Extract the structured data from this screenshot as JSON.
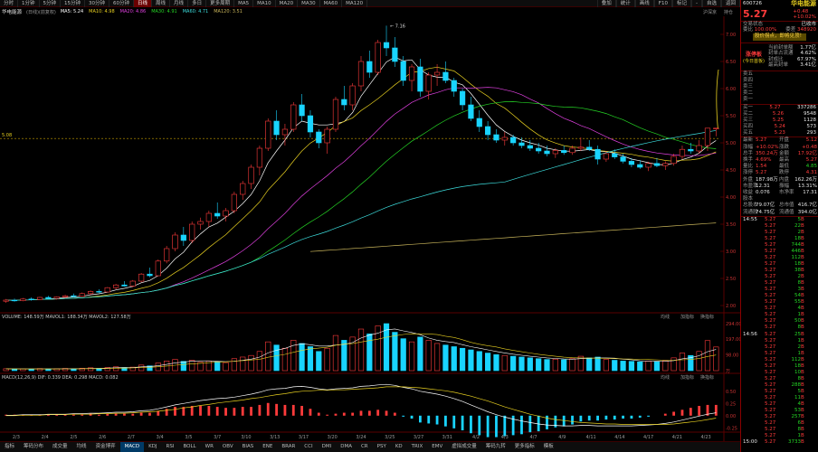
{
  "toolbar": {
    "periods": [
      "分时",
      "1分钟",
      "5分钟",
      "15分钟",
      "30分钟",
      "60分钟",
      "日线",
      "周线",
      "月线",
      "多日",
      "更多周期"
    ],
    "active_period": "日线",
    "indicator_tools": [
      "MA5",
      "MA10",
      "MA20",
      "MA30",
      "MA60",
      "MA120"
    ],
    "right_items": [
      "叠加",
      "统计",
      "画线",
      "F10",
      "标记",
      "-",
      "自选",
      "返回"
    ]
  },
  "ma_line": {
    "title": "华电能源",
    "period": "(日线)(前复权)",
    "items": [
      {
        "label": "MA5: 5.24",
        "color": "#ffffff"
      },
      {
        "label": "MA10: 4.98",
        "color": "#e8d020"
      },
      {
        "label": "MA20: 4.86",
        "color": "#e040e0"
      },
      {
        "label": "MA30: 4.91",
        "color": "#25d425"
      },
      {
        "label": "MA60: 4.71",
        "color": "#3cdcdc"
      },
      {
        "label": "MA120: 3.51",
        "color": "#c8b45a"
      }
    ],
    "tags": [
      "沪深京",
      "持仓"
    ]
  },
  "chart_labels": {
    "high_marker": "7.16",
    "current_marker": "5.08",
    "vol_header": "VOLUME: 148.59万  MAVOL1: 188.34万  MAVOL2: 127.58万",
    "vol_tools": [
      "均线",
      "加指标",
      "换指标"
    ],
    "macd_header": "MACD(12,26,9)  DIF: 0.339  DEA: 0.298  MACD: 0.082",
    "macd_tools": [
      "均线",
      "加指标",
      "换指标"
    ],
    "price_axis": [
      "7.00",
      "6.50",
      "6.00",
      "5.50",
      "5.00",
      "4.50",
      "4.00",
      "3.50",
      "3.00",
      "2.50",
      "2.00"
    ],
    "vol_axis": [
      "294.00",
      "197.00",
      "98.00",
      "万"
    ],
    "macd_axis": [
      "0.50",
      "0.25",
      "0.00",
      "-0.25"
    ],
    "date_axis": [
      "2/3",
      "2/4",
      "2/5",
      "2/6",
      "2/7",
      "3/4",
      "3/5",
      "3/7",
      "3/10",
      "3/13",
      "3/17",
      "3/20",
      "3/24",
      "3/25",
      "3/27",
      "3/31",
      "4/2",
      "4/3",
      "4/7",
      "4/9",
      "4/11",
      "4/14",
      "4/17",
      "4/21",
      "4/23"
    ]
  },
  "bottom_tabs": {
    "items": [
      "指标",
      "筹码分布",
      "成交量",
      "均线",
      "资金博弈",
      "MACD",
      "KDJ",
      "RSI",
      "BOLL",
      "WR",
      "OBV",
      "BIAS",
      "ENE",
      "BRAR",
      "CCI",
      "DMI",
      "DMA",
      "CR",
      "PSY",
      "KD",
      "TRIX",
      "EMV",
      "虚拟成交量",
      "筹码九转",
      "更多指标",
      "模板"
    ],
    "active": "MACD"
  },
  "panel": {
    "code": "600726",
    "name": "华电能源",
    "price": "5.27",
    "change": "+0.48",
    "change_pct": "+10.02%",
    "status": "交易状态",
    "status_val": "已收市",
    "weibi_label": "委比",
    "weibi": "100.00%",
    "weicha_label": "委差",
    "weicha": "348920",
    "news": "股价拐点，即将见顶！",
    "rank_title": "涨停板",
    "rank_sub": "(今日首板)",
    "rank_items": [
      {
        "k": "当前封单额",
        "v": "1.77亿"
      },
      {
        "k": "封单占流通",
        "v": "4.62%"
      },
      {
        "k": "封成比",
        "v": "67.97%"
      },
      {
        "k": "最高封单",
        "v": "3.41亿"
      }
    ],
    "sells": [
      {
        "k": "卖五",
        "p": "",
        "v": ""
      },
      {
        "k": "卖四",
        "p": "",
        "v": ""
      },
      {
        "k": "卖三",
        "p": "",
        "v": ""
      },
      {
        "k": "卖二",
        "p": "",
        "v": ""
      },
      {
        "k": "卖一",
        "p": "",
        "v": ""
      }
    ],
    "buys": [
      {
        "k": "买一",
        "p": "5.27",
        "v": "337286"
      },
      {
        "k": "买二",
        "p": "5.26",
        "v": "9548"
      },
      {
        "k": "买三",
        "p": "5.25",
        "v": "1128"
      },
      {
        "k": "买四",
        "p": "5.24",
        "v": "573"
      },
      {
        "k": "买五",
        "p": "5.23",
        "v": "293"
      }
    ],
    "stats": [
      {
        "k": "最新",
        "v": "5.27",
        "k2": "开盘",
        "v2": "5.12"
      },
      {
        "k": "涨幅",
        "v": "+10.02%",
        "k2": "涨跌",
        "v2": "+0.48"
      },
      {
        "k": "总手",
        "v": "350.24万",
        "k2": "金额",
        "v2": "17.92亿"
      },
      {
        "k": "换手",
        "v": "4.69%",
        "k2": "最高",
        "v2": "5.27"
      },
      {
        "k": "量比",
        "v": "1.54",
        "k2": "最低",
        "v2": "4.85"
      },
      {
        "k": "涨停",
        "v": "5.27",
        "k2": "跌停",
        "v2": "4.31"
      },
      {
        "k": "外盘",
        "v": "187.98万",
        "k2": "内盘",
        "v2": "162.26万"
      },
      {
        "k": "市盈率",
        "v": "12.31",
        "k2": "振幅",
        "v2": "13.31%"
      },
      {
        "k": "收益",
        "v": "0.076",
        "k2": "市净率",
        "v2": "17.31"
      },
      {
        "k": "股本",
        "v": "",
        "k2": "",
        "v2": ""
      },
      {
        "k": "总股本",
        "v": "79.07亿",
        "k2": "总市值",
        "v2": "416.7亿"
      },
      {
        "k": "流通股",
        "v": "74.75亿",
        "k2": "流通值",
        "v2": "394.0亿"
      }
    ],
    "ticks": [
      {
        "t": "14:55",
        "p": "5.27",
        "v": "5"
      },
      {
        "t": "",
        "p": "5.27",
        "v": "22"
      },
      {
        "t": "",
        "p": "5.27",
        "v": "2"
      },
      {
        "t": "",
        "p": "5.27",
        "v": "18"
      },
      {
        "t": "",
        "p": "5.27",
        "v": "744"
      },
      {
        "t": "",
        "p": "5.27",
        "v": "446"
      },
      {
        "t": "",
        "p": "5.27",
        "v": "112"
      },
      {
        "t": "",
        "p": "5.27",
        "v": "18"
      },
      {
        "t": "",
        "p": "5.27",
        "v": "38"
      },
      {
        "t": "",
        "p": "5.27",
        "v": "2"
      },
      {
        "t": "",
        "p": "5.27",
        "v": "8"
      },
      {
        "t": "",
        "p": "5.27",
        "v": "3"
      },
      {
        "t": "",
        "p": "5.27",
        "v": "54"
      },
      {
        "t": "",
        "p": "5.27",
        "v": "55"
      },
      {
        "t": "",
        "p": "5.27",
        "v": "4"
      },
      {
        "t": "",
        "p": "5.27",
        "v": "1"
      },
      {
        "t": "",
        "p": "5.27",
        "v": "50"
      },
      {
        "t": "",
        "p": "5.27",
        "v": "8"
      },
      {
        "t": "14:56",
        "p": "5.27",
        "v": "25"
      },
      {
        "t": "",
        "p": "5.27",
        "v": "1"
      },
      {
        "t": "",
        "p": "5.27",
        "v": "2"
      },
      {
        "t": "",
        "p": "5.27",
        "v": "1"
      },
      {
        "t": "",
        "p": "5.27",
        "v": "112"
      },
      {
        "t": "",
        "p": "5.27",
        "v": "18"
      },
      {
        "t": "",
        "p": "5.27",
        "v": "10"
      },
      {
        "t": "",
        "p": "5.27",
        "v": "8"
      },
      {
        "t": "",
        "p": "5.27",
        "v": "288"
      },
      {
        "t": "",
        "p": "5.27",
        "v": "5"
      },
      {
        "t": "",
        "p": "5.27",
        "v": "11"
      },
      {
        "t": "",
        "p": "5.27",
        "v": "4"
      },
      {
        "t": "",
        "p": "5.27",
        "v": "53"
      },
      {
        "t": "",
        "p": "5.27",
        "v": "257"
      },
      {
        "t": "",
        "p": "5.27",
        "v": "6"
      },
      {
        "t": "",
        "p": "5.27",
        "v": "8"
      },
      {
        "t": "",
        "p": "5.27",
        "v": "1"
      },
      {
        "t": "15:00",
        "p": "5.27",
        "v": "3733"
      }
    ],
    "tick_flags": [
      "B",
      "B",
      "B",
      "B",
      "B",
      "B",
      "B",
      "B",
      "B",
      "B",
      "B",
      "B",
      "B",
      "B",
      "B",
      "B",
      "B",
      "B",
      "B",
      "B",
      "B",
      "B",
      "B",
      "B",
      "B",
      "B",
      "B",
      "B",
      "B",
      "B",
      "B",
      "B",
      "B",
      "B",
      "B",
      "B"
    ]
  },
  "chart_data": {
    "type": "candlestick",
    "colors": {
      "up": "#ff3b3b",
      "down": "#19d4ff",
      "ma5": "#ffffff",
      "ma10": "#e8d020",
      "ma20": "#e040e0",
      "ma30": "#25d425",
      "ma60": "#3cdcdc",
      "ma120": "#c8b45a"
    },
    "ohlc": [
      [
        2.08,
        2.12,
        2.05,
        2.1
      ],
      [
        2.1,
        2.13,
        2.07,
        2.09
      ],
      [
        2.09,
        2.14,
        2.08,
        2.12
      ],
      [
        2.12,
        2.15,
        2.09,
        2.11
      ],
      [
        2.11,
        2.16,
        2.1,
        2.15
      ],
      [
        2.15,
        2.18,
        2.12,
        2.13
      ],
      [
        2.13,
        2.17,
        2.11,
        2.16
      ],
      [
        2.16,
        2.2,
        2.14,
        2.18
      ],
      [
        2.18,
        2.22,
        2.15,
        2.17
      ],
      [
        2.17,
        2.24,
        2.16,
        2.22
      ],
      [
        2.22,
        2.28,
        2.2,
        2.26
      ],
      [
        2.26,
        2.3,
        2.23,
        2.25
      ],
      [
        2.25,
        2.34,
        2.24,
        2.33
      ],
      [
        2.33,
        2.4,
        2.3,
        2.38
      ],
      [
        2.38,
        2.45,
        2.35,
        2.36
      ],
      [
        2.36,
        2.47,
        2.34,
        2.45
      ],
      [
        2.45,
        2.6,
        2.43,
        2.58
      ],
      [
        2.58,
        2.7,
        2.52,
        2.55
      ],
      [
        2.55,
        2.85,
        2.54,
        2.82
      ],
      [
        2.82,
        3.1,
        2.78,
        3.05
      ],
      [
        3.05,
        3.35,
        3.0,
        3.3
      ],
      [
        3.3,
        3.45,
        3.1,
        3.2
      ],
      [
        3.2,
        3.55,
        3.15,
        3.5
      ],
      [
        3.5,
        3.62,
        3.4,
        3.55
      ],
      [
        3.55,
        3.75,
        3.45,
        3.7
      ],
      [
        3.7,
        3.9,
        3.6,
        3.65
      ],
      [
        3.65,
        3.8,
        3.55,
        3.75
      ],
      [
        3.75,
        4.1,
        3.7,
        4.05
      ],
      [
        4.05,
        4.3,
        3.95,
        4.25
      ],
      [
        4.25,
        4.6,
        4.15,
        4.55
      ],
      [
        4.55,
        4.95,
        4.4,
        4.9
      ],
      [
        4.9,
        5.45,
        4.85,
        5.4
      ],
      [
        5.4,
        5.6,
        5.05,
        5.15
      ],
      [
        5.15,
        5.35,
        4.95,
        5.25
      ],
      [
        5.25,
        5.75,
        5.2,
        5.7
      ],
      [
        5.7,
        5.9,
        5.4,
        5.5
      ],
      [
        5.5,
        5.6,
        5.1,
        5.2
      ],
      [
        5.2,
        5.25,
        4.9,
        5.0
      ],
      [
        5.0,
        5.3,
        4.8,
        5.25
      ],
      [
        5.25,
        5.85,
        5.2,
        5.8
      ],
      [
        5.8,
        6.05,
        5.6,
        5.7
      ],
      [
        5.7,
        6.1,
        5.6,
        6.05
      ],
      [
        6.05,
        6.6,
        5.95,
        6.5
      ],
      [
        6.5,
        6.7,
        6.2,
        6.3
      ],
      [
        6.3,
        6.9,
        6.25,
        6.85
      ],
      [
        6.85,
        7.16,
        6.6,
        6.75
      ],
      [
        6.75,
        6.95,
        6.4,
        6.5
      ],
      [
        6.5,
        6.6,
        6.05,
        6.15
      ],
      [
        6.15,
        6.45,
        5.95,
        6.4
      ],
      [
        6.4,
        6.55,
        5.85,
        5.95
      ],
      [
        5.95,
        6.3,
        5.8,
        6.25
      ],
      [
        6.25,
        6.45,
        6.05,
        6.3
      ],
      [
        6.3,
        6.5,
        6.1,
        6.15
      ],
      [
        6.15,
        6.2,
        5.85,
        5.95
      ],
      [
        5.95,
        6.0,
        5.6,
        5.7
      ],
      [
        5.7,
        5.85,
        5.4,
        5.45
      ],
      [
        5.45,
        5.6,
        5.2,
        5.3
      ],
      [
        5.3,
        5.4,
        5.05,
        5.15
      ],
      [
        5.15,
        5.25,
        5.0,
        5.05
      ],
      [
        5.05,
        5.2,
        4.95,
        5.1
      ],
      [
        5.1,
        5.15,
        4.95,
        5.0
      ],
      [
        5.0,
        5.1,
        4.9,
        4.95
      ],
      [
        4.95,
        5.05,
        4.85,
        4.9
      ],
      [
        4.9,
        5.0,
        4.8,
        4.85
      ],
      [
        4.85,
        4.95,
        4.75,
        4.8
      ],
      [
        4.8,
        4.9,
        4.72,
        4.86
      ],
      [
        4.86,
        4.95,
        4.78,
        4.82
      ],
      [
        4.82,
        4.95,
        4.78,
        4.9
      ],
      [
        4.9,
        5.1,
        4.85,
        4.92
      ],
      [
        4.92,
        5.05,
        4.85,
        4.88
      ],
      [
        4.88,
        4.95,
        4.6,
        4.7
      ],
      [
        4.7,
        4.85,
        4.65,
        4.8
      ],
      [
        4.8,
        4.88,
        4.7,
        4.74
      ],
      [
        4.74,
        4.8,
        4.62,
        4.66
      ],
      [
        4.66,
        4.72,
        4.55,
        4.6
      ],
      [
        4.6,
        4.68,
        4.52,
        4.55
      ],
      [
        4.55,
        4.65,
        4.48,
        4.62
      ],
      [
        4.62,
        4.72,
        4.55,
        4.58
      ],
      [
        4.58,
        4.66,
        4.5,
        4.62
      ],
      [
        4.62,
        4.8,
        4.58,
        4.75
      ],
      [
        4.75,
        4.95,
        4.7,
        4.88
      ],
      [
        4.88,
        5.0,
        4.8,
        4.85
      ],
      [
        4.85,
        5.05,
        4.8,
        4.95
      ],
      [
        4.95,
        5.27,
        4.85,
        5.27
      ],
      [
        5.27,
        5.27,
        5.12,
        5.27
      ]
    ],
    "volume": [
      12,
      10,
      11,
      9,
      13,
      10,
      12,
      14,
      11,
      15,
      18,
      14,
      20,
      24,
      19,
      22,
      35,
      30,
      48,
      60,
      70,
      58,
      65,
      52,
      60,
      55,
      50,
      75,
      85,
      95,
      120,
      180,
      160,
      140,
      190,
      170,
      150,
      120,
      140,
      220,
      190,
      210,
      260,
      230,
      280,
      294,
      240,
      200,
      180,
      210,
      190,
      170,
      160,
      150,
      140,
      130,
      120,
      110,
      100,
      95,
      90,
      85,
      80,
      75,
      70,
      72,
      68,
      75,
      90,
      80,
      85,
      70,
      65,
      60,
      58,
      55,
      60,
      58,
      62,
      80,
      110,
      95,
      120,
      188,
      148
    ],
    "macd": {
      "dif": [
        0.01,
        0.01,
        0.02,
        0.02,
        0.02,
        0.03,
        0.03,
        0.03,
        0.04,
        0.04,
        0.05,
        0.05,
        0.06,
        0.07,
        0.07,
        0.08,
        0.1,
        0.11,
        0.14,
        0.18,
        0.22,
        0.25,
        0.28,
        0.31,
        0.33,
        0.35,
        0.36,
        0.38,
        0.41,
        0.44,
        0.48,
        0.53,
        0.55,
        0.56,
        0.59,
        0.6,
        0.58,
        0.55,
        0.53,
        0.55,
        0.56,
        0.57,
        0.6,
        0.61,
        0.63,
        0.64,
        0.62,
        0.58,
        0.55,
        0.5,
        0.47,
        0.44,
        0.4,
        0.35,
        0.29,
        0.22,
        0.15,
        0.08,
        0.02,
        -0.03,
        -0.07,
        -0.11,
        -0.14,
        -0.17,
        -0.19,
        -0.2,
        -0.21,
        -0.21,
        -0.2,
        -0.2,
        -0.21,
        -0.21,
        -0.21,
        -0.21,
        -0.21,
        -0.2,
        -0.19,
        -0.18,
        -0.16,
        -0.13,
        -0.09,
        -0.05,
        -0.01,
        0.03,
        0.06
      ],
      "dea": [
        0.0,
        0.0,
        0.01,
        0.01,
        0.01,
        0.02,
        0.02,
        0.02,
        0.03,
        0.03,
        0.03,
        0.04,
        0.04,
        0.05,
        0.05,
        0.06,
        0.07,
        0.08,
        0.09,
        0.11,
        0.13,
        0.16,
        0.18,
        0.21,
        0.23,
        0.26,
        0.28,
        0.3,
        0.32,
        0.35,
        0.37,
        0.4,
        0.43,
        0.45,
        0.48,
        0.5,
        0.51,
        0.52,
        0.52,
        0.53,
        0.53,
        0.54,
        0.55,
        0.56,
        0.57,
        0.59,
        0.59,
        0.59,
        0.58,
        0.57,
        0.55,
        0.53,
        0.51,
        0.48,
        0.44,
        0.4,
        0.35,
        0.3,
        0.24,
        0.18,
        0.13,
        0.08,
        0.03,
        -0.01,
        -0.05,
        -0.08,
        -0.1,
        -0.12,
        -0.14,
        -0.15,
        -0.16,
        -0.17,
        -0.17,
        -0.18,
        -0.18,
        -0.18,
        -0.18,
        -0.18,
        -0.18,
        -0.17,
        -0.15,
        -0.13,
        -0.11,
        -0.08,
        -0.05
      ]
    },
    "ylim": [
      1.9,
      7.3
    ]
  }
}
